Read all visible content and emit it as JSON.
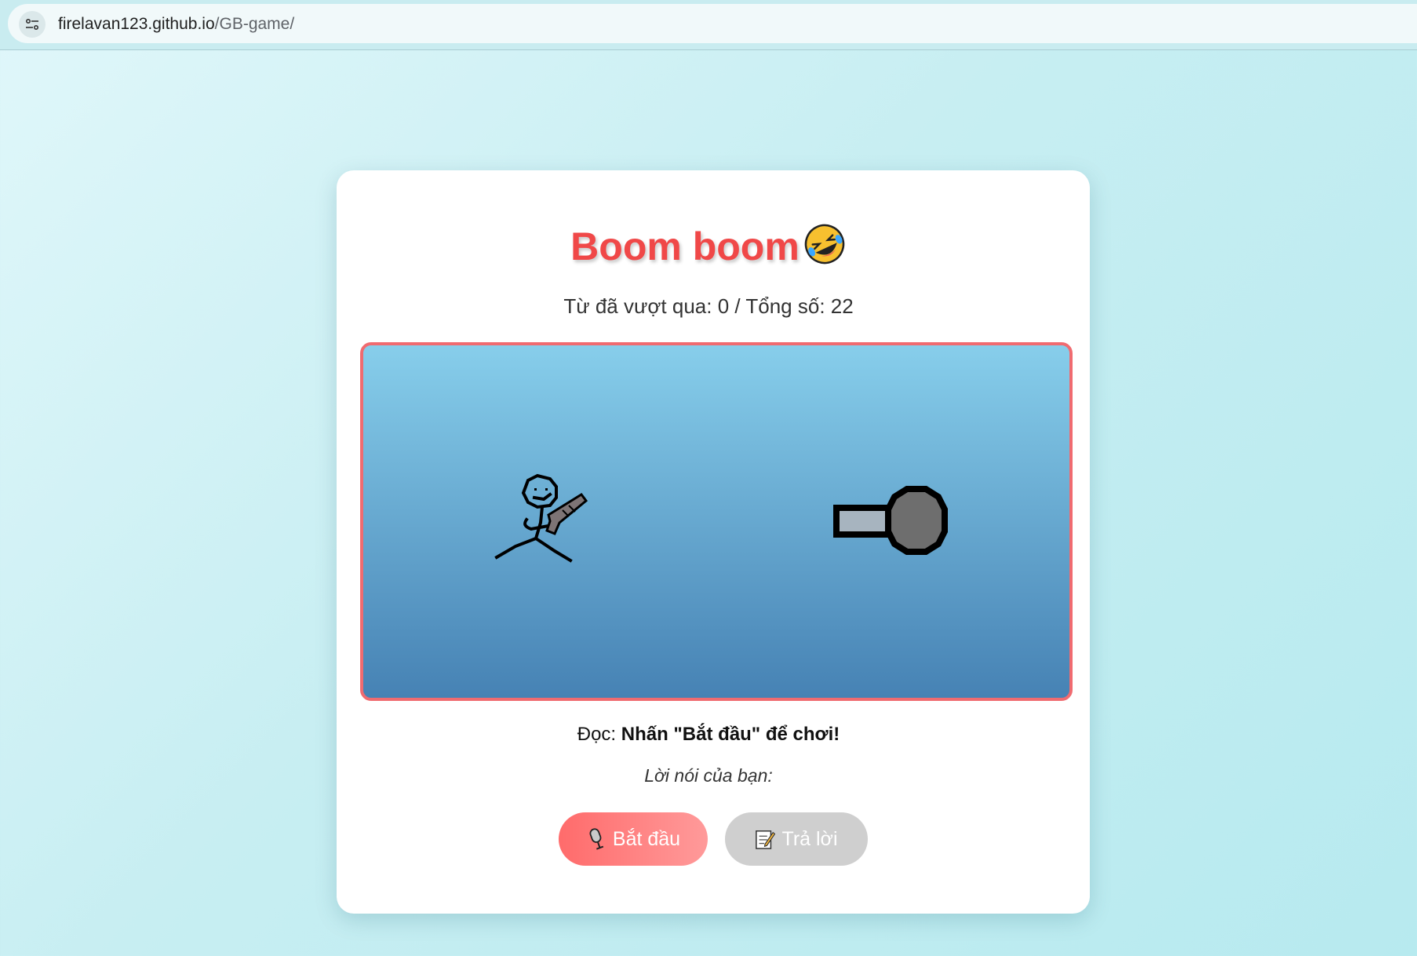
{
  "browser": {
    "url_host": "firelavan123.github.io",
    "url_path": "/GB-game/",
    "site_icon": "site-settings-icon"
  },
  "game": {
    "title": "Boom boom",
    "title_icon": "rolling-laughing-emoji-icon",
    "score_label": "Từ đã vượt qua: ",
    "score_passed": "0",
    "score_separator": " / Tổng số: ",
    "score_total": "22",
    "prompt_label": "Đọc: ",
    "prompt_text": "Nhấn \"Bắt đầu\" để chơi!",
    "speech_label": "Lời nói của bạn:",
    "speech_text": ""
  },
  "scene": {
    "characters": [
      "stick-figure-with-gun",
      "cannon"
    ],
    "colors": {
      "sky_top": "#87ceeb",
      "sky_bottom": "#4682b4",
      "border": "#f06b70"
    }
  },
  "buttons": {
    "start_label": "Bắt đầu",
    "start_icon": "microphone-icon",
    "answer_label": "Trả lời",
    "answer_icon": "memo-icon"
  },
  "colors": {
    "title": "#f04848",
    "start_button": "#ff6b6b",
    "answer_button": "#cfcfcf"
  }
}
